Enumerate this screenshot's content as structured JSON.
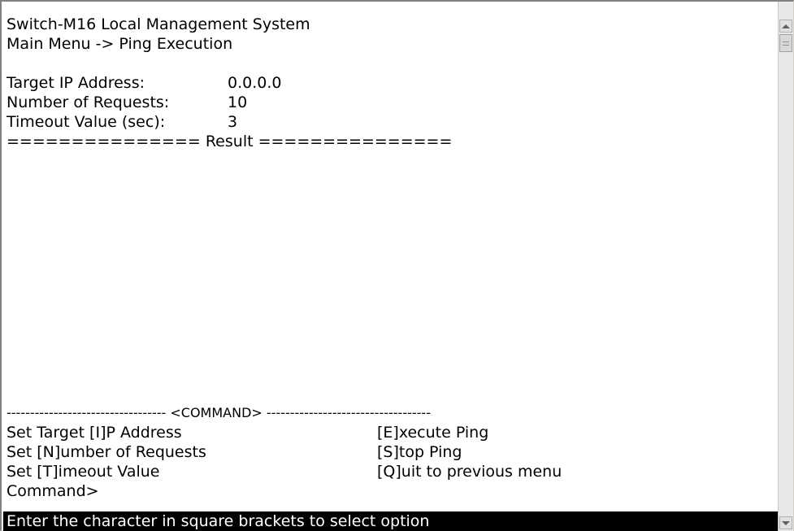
{
  "header": {
    "title": "Switch-M16 Local Management System",
    "breadcrumb": "Main Menu -> Ping Execution"
  },
  "fields": [
    {
      "label": "Target IP Address:",
      "value": "0.0.0.0"
    },
    {
      "label": "Number of Requests:",
      "value": "10"
    },
    {
      "label": "Timeout Value (sec):",
      "value": "3"
    }
  ],
  "result_divider": "=============== Result ===============",
  "command_divider": "---------------------------------- <COMMAND> -----------------------------------",
  "commands": {
    "left": [
      "Set Target [I]P Address",
      "Set [N]umber of Requests",
      "Set [T]imeout Value"
    ],
    "right": [
      "[E]xecute Ping",
      "[S]top Ping",
      "[Q]uit to previous menu"
    ]
  },
  "prompt": "Command>",
  "status": "Enter the character in square brackets to select option"
}
